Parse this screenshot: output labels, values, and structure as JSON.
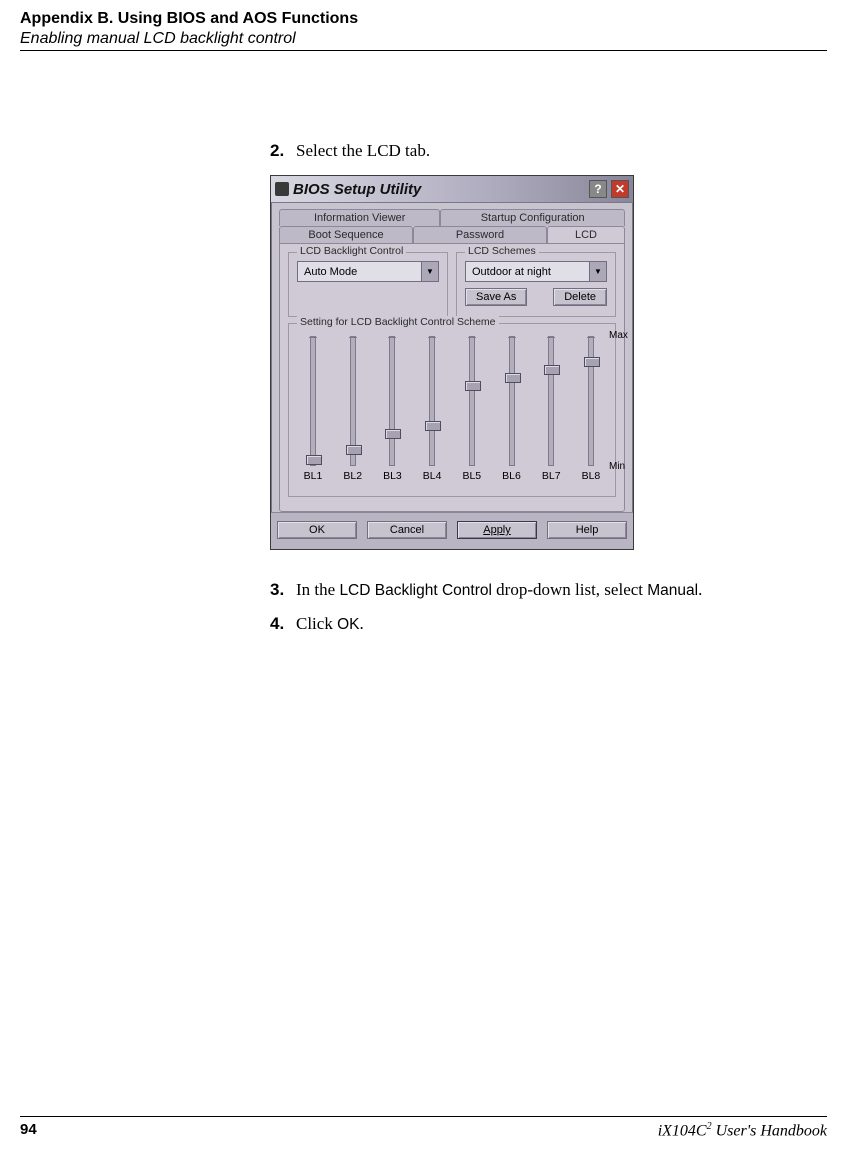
{
  "header": {
    "title": "Appendix B. Using BIOS and AOS Functions",
    "subtitle": "Enabling manual LCD backlight control"
  },
  "steps": {
    "s2": {
      "num": "2.",
      "text": "Select the LCD tab."
    },
    "s3": {
      "num": "3.",
      "text_before": "In the ",
      "sans1": "LCD Backlight Control",
      "text_mid": " drop-down list, select ",
      "sans2": "Manual",
      "text_after": "."
    },
    "s4": {
      "num": "4.",
      "text_before": "Click ",
      "sans1": "OK",
      "text_after": "."
    }
  },
  "dialog": {
    "title": "BIOS Setup Utility",
    "tabs_row1": {
      "a": "Information Viewer",
      "b": "Startup Configuration"
    },
    "tabs_row2": {
      "a": "Boot Sequence",
      "b": "Password",
      "c": "LCD"
    },
    "group_backlight": {
      "title": "LCD Backlight Control",
      "value": "Auto Mode"
    },
    "group_schemes": {
      "title": "LCD Schemes",
      "value": "Outdoor at night",
      "save": "Save As",
      "delete": "Delete"
    },
    "group_setting": {
      "title": "Setting for LCD Backlight Control Scheme",
      "max": "Max",
      "min": "Min",
      "sliders": [
        {
          "label": "BL1"
        },
        {
          "label": "BL2"
        },
        {
          "label": "BL3"
        },
        {
          "label": "BL4"
        },
        {
          "label": "BL5"
        },
        {
          "label": "BL6"
        },
        {
          "label": "BL7"
        },
        {
          "label": "BL8"
        }
      ]
    },
    "buttons": {
      "ok": "OK",
      "cancel": "Cancel",
      "apply": "Apply",
      "help": "Help"
    }
  },
  "footer": {
    "page": "94",
    "book_pre": "iX104C",
    "book_sup": "2",
    "book_post": " User's Handbook"
  }
}
